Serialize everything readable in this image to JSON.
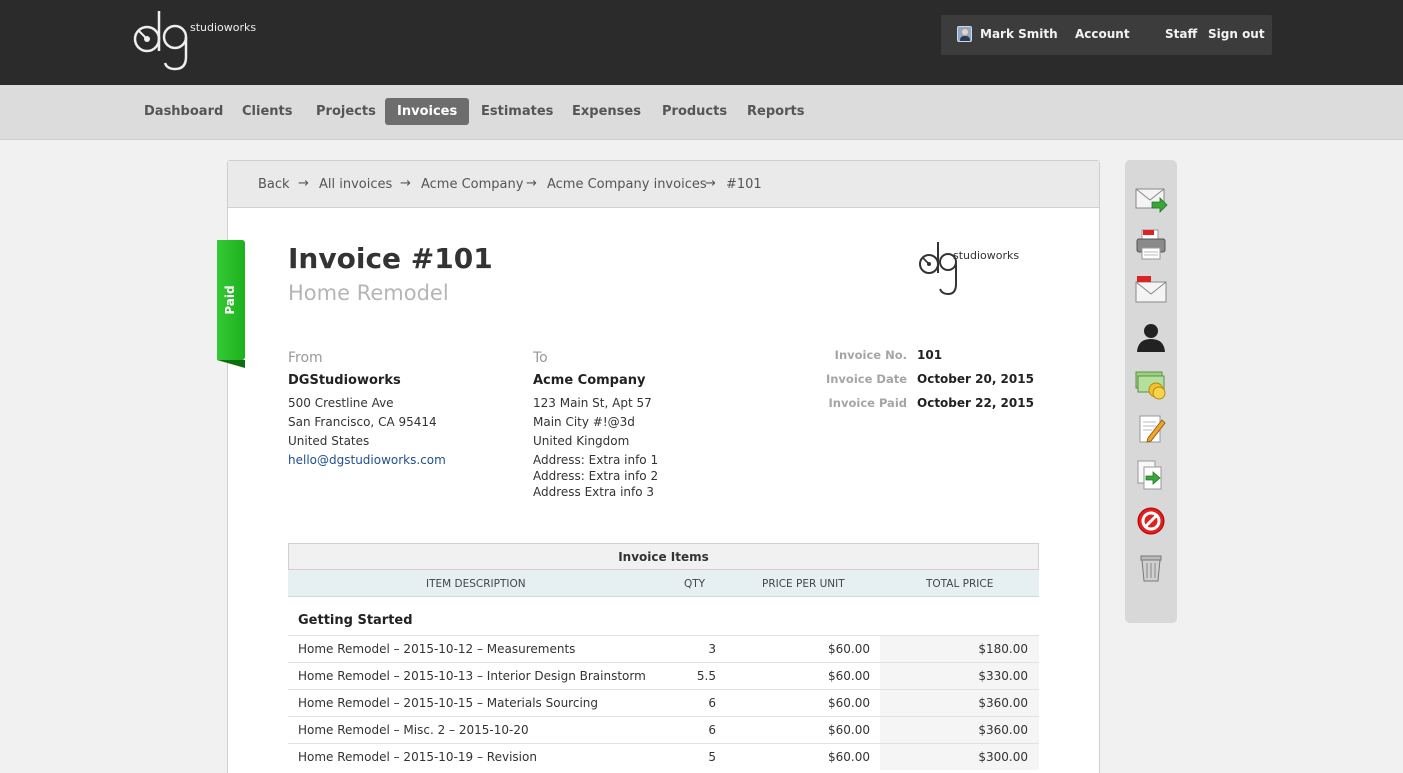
{
  "brand": {
    "logo_text": "studioworks"
  },
  "user_menu": {
    "user_name": "Mark Smith",
    "account": "Account",
    "staff": "Staff",
    "sign_out": "Sign out"
  },
  "nav": {
    "items": [
      {
        "label": "Dashboard"
      },
      {
        "label": "Clients"
      },
      {
        "label": "Projects"
      },
      {
        "label": "Invoices",
        "active": true
      },
      {
        "label": "Estimates"
      },
      {
        "label": "Expenses"
      },
      {
        "label": "Products"
      },
      {
        "label": "Reports"
      }
    ]
  },
  "breadcrumb": {
    "items": [
      "Back",
      "All invoices",
      "Acme Company",
      "Acme Company invoices",
      "#101"
    ],
    "separator": "→"
  },
  "status_ribbon": {
    "label": "Paid",
    "color": "#22b922"
  },
  "invoice": {
    "title": "Invoice #101",
    "project": "Home Remodel",
    "from": {
      "heading": "From",
      "name": "DGStudioworks",
      "lines": [
        "500 Crestline Ave",
        "San Francisco, CA 95414",
        "United States"
      ],
      "email": "hello@dgstudioworks.com"
    },
    "to": {
      "heading": "To",
      "name": "Acme Company",
      "lines": [
        "123 Main St, Apt 57",
        "Main City #!@3d",
        "United Kingdom",
        "Address: Extra info 1",
        "Address: Extra info 2",
        "Address Extra info 3"
      ]
    },
    "meta": {
      "number_label": "Invoice No.",
      "number": "101",
      "date_label": "Invoice Date",
      "date": "October 20, 2015",
      "paid_label": "Invoice Paid",
      "paid": "October 22, 2015"
    }
  },
  "items_table": {
    "title": "Invoice Items",
    "columns": [
      "ITEM DESCRIPTION",
      "QTY",
      "PRICE PER UNIT",
      "TOTAL PRICE"
    ],
    "group": "Getting Started",
    "rows": [
      {
        "description": "Home Remodel – 2015-10-12 – Measurements",
        "qty": "3",
        "price": "$60.00",
        "total": "$180.00"
      },
      {
        "description": "Home Remodel – 2015-10-13 – Interior Design Brainstorm",
        "qty": "5.5",
        "price": "$60.00",
        "total": "$330.00"
      },
      {
        "description": "Home Remodel – 2015-10-15 – Materials Sourcing",
        "qty": "6",
        "price": "$60.00",
        "total": "$360.00"
      },
      {
        "description": "Home Remodel – Misc. 2 – 2015-10-20",
        "qty": "6",
        "price": "$60.00",
        "total": "$360.00"
      },
      {
        "description": "Home Remodel – 2015-10-19 – Revision",
        "qty": "5",
        "price": "$60.00",
        "total": "$300.00"
      }
    ]
  },
  "actions": [
    {
      "icon": "email-send-icon"
    },
    {
      "icon": "pdf-print-icon"
    },
    {
      "icon": "pdf-email-icon"
    },
    {
      "icon": "client-icon"
    },
    {
      "icon": "payment-icon"
    },
    {
      "icon": "edit-icon"
    },
    {
      "icon": "duplicate-icon"
    },
    {
      "icon": "cancel-icon"
    },
    {
      "icon": "trash-icon"
    }
  ]
}
